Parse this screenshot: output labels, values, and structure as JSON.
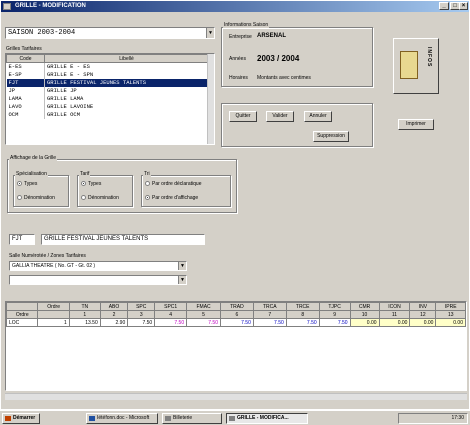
{
  "window": {
    "title": "GRILLE - MODIFICATION"
  },
  "saison_select": {
    "value": "SAISON 2003-2004"
  },
  "info_saison": {
    "label": "Informations Saison",
    "entreprise_label": "Entreprise",
    "entreprise": "ARSENAL",
    "annees_label": "Années",
    "annees": "2003 / 2004",
    "horaires_label": "Horaires",
    "horaires": "Montants avec centimes"
  },
  "grilles": {
    "label": "Grilles Tarifaires",
    "col_code": "Code",
    "col_libelle": "Libellé",
    "rows": [
      {
        "code": "E-ES",
        "libelle": "GRILLE E - ES"
      },
      {
        "code": "E-SP",
        "libelle": "GRILLE E - SPN"
      },
      {
        "code": "FJT",
        "libelle": "GRILLE FESTIVAL JEUNES TALENTS"
      },
      {
        "code": "JP",
        "libelle": "GRILLE JP"
      },
      {
        "code": "LAMA",
        "libelle": "GRILLE LAMA"
      },
      {
        "code": "LAVO",
        "libelle": "GRILLE LAVOINE"
      },
      {
        "code": "OCM",
        "libelle": "GRILLE OCM"
      }
    ],
    "selected_index": 2
  },
  "buttons": {
    "quitter": "Quitter",
    "valider": "Valider",
    "annuler": "Annuler",
    "suppression": "Suppression",
    "imprimer": "Imprimer"
  },
  "infos_logo": "INFOS",
  "affichage": {
    "label": "Affichage de la Grille",
    "specialisation": {
      "label": "Spécialisation",
      "opt1": "Types",
      "opt2": "Dénomination"
    },
    "tarif": {
      "label": "Tarif",
      "opt1": "Types",
      "opt2": "Dénomination"
    },
    "tri": {
      "label": "Tri",
      "opt1": "Par ordre déclaratique",
      "opt2": "Par ordre d'affichage"
    }
  },
  "code_field": {
    "code": "FJT",
    "libelle": "GRILLE FESTIVAL JEUNES TALENTS"
  },
  "salle": {
    "label": "Salle Numérotée / Zones Tarifaires",
    "value": "GALLIA THEATRE ( No. GT - Gt. 02 )",
    "value2": ""
  },
  "grid": {
    "headers": [
      "",
      "Ordre",
      "TN",
      "ABO",
      "SPC",
      "SPC1",
      "FMAC",
      "TRAD",
      "TRCA",
      "TRCE",
      "TJPC",
      "CMR",
      "ICON",
      "INV",
      "IPRE"
    ],
    "row_ordre": [
      "Ordre",
      "",
      "1",
      "2",
      "3",
      "4",
      "5",
      "6",
      "7",
      "8",
      "9",
      "10",
      "11",
      "12",
      "13"
    ],
    "row_data": [
      "LOC",
      "1",
      "13.50",
      "2.90",
      "7.50",
      "7.50",
      "7.50",
      "7.50",
      "7.50",
      "7.50",
      "7.50",
      "0.00",
      "0.00",
      "0.00",
      "0.00"
    ]
  },
  "taskbar": {
    "start": "Démarrer",
    "tasks": [
      "Iétéfonn.doc - Microsoft",
      "Billeterie",
      "GRILLE - MODIFICA..."
    ],
    "clock": "17:30"
  }
}
